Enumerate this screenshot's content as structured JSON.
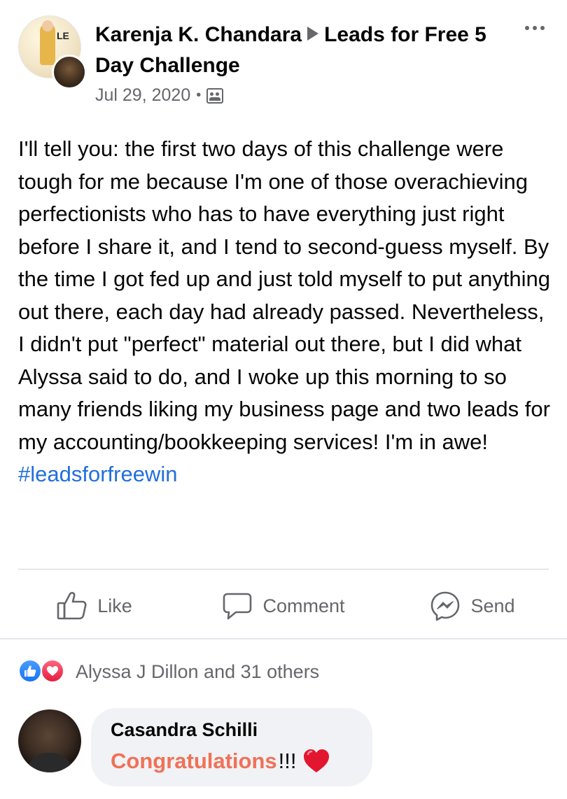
{
  "post": {
    "author": "Karenja K. Chandara",
    "group": "Leads for Free 5 Day Challenge",
    "date": "Jul 29, 2020",
    "separator": "•",
    "audience_icon": "group-icon",
    "body": "I'll tell you: the first two days of this challenge were tough for me because I'm one of those overachieving perfectionists who has to have everything just right before I share it, and I tend to second-guess myself. By the time I got fed up and just told myself to put anything out there, each day had already passed. Nevertheless, I didn't put \"perfect\" material out there, but I did what Alyssa said to do, and I woke up this morning to so many friends liking my business page and two leads for my accounting/bookkeeping services! I'm in awe!",
    "hashtag": "#leadsforfreewin",
    "group_logo_text": "LE"
  },
  "actions": {
    "like": "Like",
    "comment": "Comment",
    "send": "Send"
  },
  "reactions": {
    "summary": "Alyssa J Dillon and 31 others",
    "icons": [
      "like-reaction-icon",
      "love-reaction-icon"
    ]
  },
  "comment": {
    "author": "Casandra Schilli",
    "text_main": "Congratulations",
    "text_suffix": "!!!",
    "emoji": "heart"
  },
  "colors": {
    "link_blue": "#216fdb",
    "secondary_text": "#65676b",
    "comment_highlight": "#f07157",
    "like_blue": "#1877f2",
    "love_red": "#e41e3f"
  }
}
